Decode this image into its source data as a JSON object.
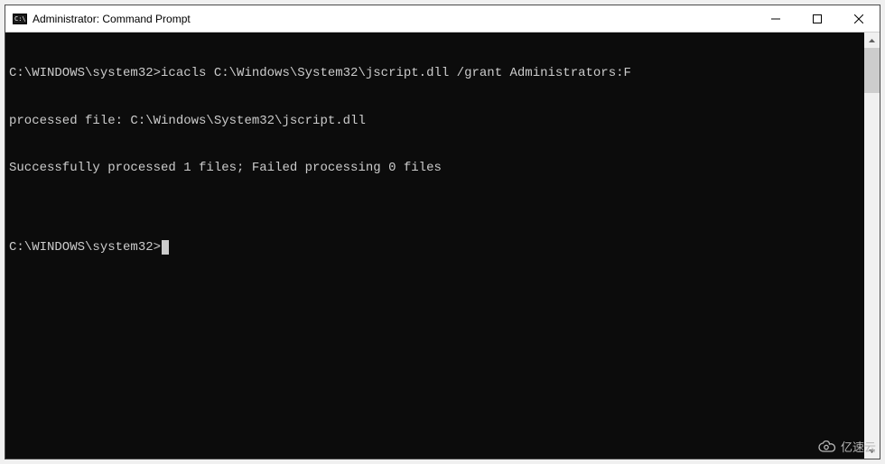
{
  "window": {
    "title": "Administrator: Command Prompt"
  },
  "terminal": {
    "lines": [
      "C:\\WINDOWS\\system32>icacls C:\\Windows\\System32\\jscript.dll /grant Administrators:F",
      "processed file: C:\\Windows\\System32\\jscript.dll",
      "Successfully processed 1 files; Failed processing 0 files",
      "",
      "C:\\WINDOWS\\system32>"
    ],
    "prompt": "C:\\WINDOWS\\system32>"
  },
  "watermark": {
    "text": "亿速云"
  }
}
